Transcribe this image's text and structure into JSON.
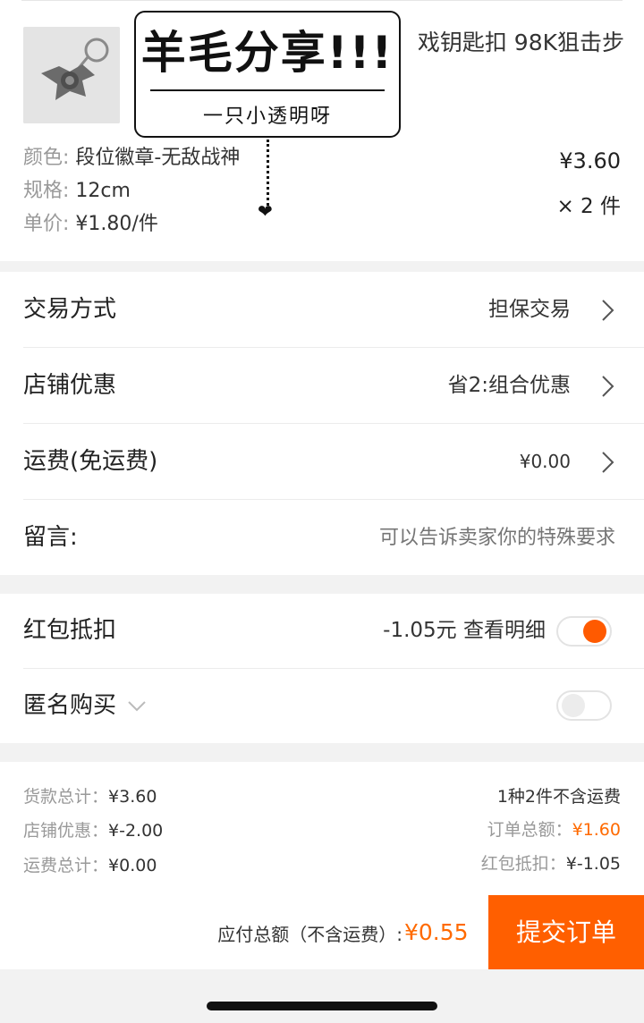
{
  "product": {
    "title": "戏钥匙扣 98K狙击步",
    "color_label": "颜色:",
    "color_value": "段位徽章-无敌战神",
    "spec_label": "规格:",
    "spec_value": "12cm",
    "unit_label": "单价:",
    "unit_value": "¥1.80/件",
    "price": "¥3.60",
    "quantity": "× 2 件"
  },
  "watermark": {
    "title": "羊毛分享!!!",
    "subtitle": "一只小透明呀"
  },
  "order_options": [
    {
      "label": "交易方式",
      "value": "担保交易"
    },
    {
      "label": "店铺优惠",
      "value": "省2:组合优惠"
    },
    {
      "label": "运费(免运费)",
      "value": "¥0.00"
    }
  ],
  "message": {
    "label": "留言:",
    "placeholder": "可以告诉卖家你的特殊要求"
  },
  "red_packet": {
    "label": "红包抵扣",
    "value": "-1.05元 查看明细",
    "enabled": true
  },
  "anonymous": {
    "label": "匿名购买",
    "enabled": false
  },
  "summary": {
    "goods_total_label": "货款总计：",
    "goods_total": "¥3.60",
    "shop_discount_label": "店铺优惠：",
    "shop_discount": "¥-2.00",
    "shipping_label": "运费总计：",
    "shipping": "¥0.00",
    "items_note": "1种2件不含运费",
    "order_total_label": "订单总额：",
    "order_total": "¥1.60",
    "red_packet_label": "红包抵扣：",
    "red_packet": "¥-1.05"
  },
  "footer": {
    "payable_label": "应付总额（不含运费）:",
    "payable_amount": "¥0.55",
    "submit_label": "提交订单"
  },
  "colors": {
    "accent": "#ff5f00",
    "price_orange": "#ff6a00",
    "background": "#f2f2f2"
  }
}
